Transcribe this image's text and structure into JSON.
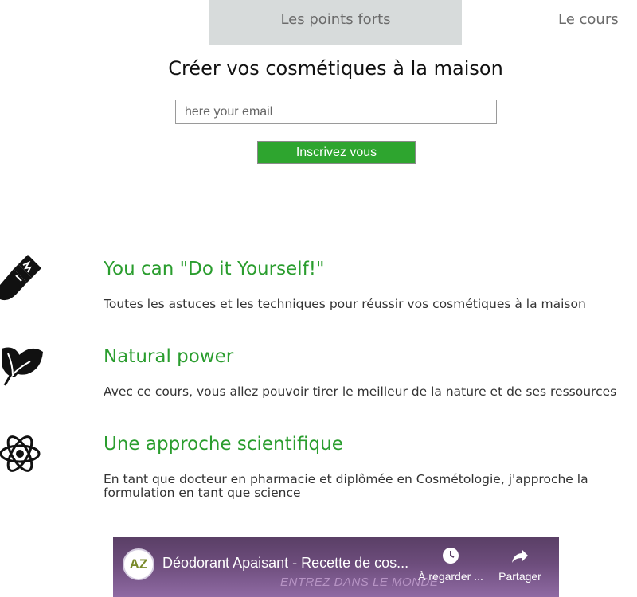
{
  "nav": {
    "tabs": [
      {
        "label": "Les points forts",
        "active": true
      },
      {
        "label": "Le cours",
        "active": false
      }
    ]
  },
  "hero": {
    "title": "Créer vos cosmétiques à la maison",
    "email_placeholder": "here your email",
    "subscribe_label": "Inscrivez vous"
  },
  "features": [
    {
      "icon": "paintbrush-icon",
      "title": "You can \"Do it Yourself!\"",
      "text": "Toutes les astuces et les techniques pour réussir vos cosmétiques à la maison"
    },
    {
      "icon": "leaf-icon",
      "title": "Natural power",
      "text": "Avec ce cours, vous allez pouvoir tirer le meilleur de la nature et de ses ressources"
    },
    {
      "icon": "atom-icon",
      "title": "Une approche scientifique",
      "text": "En tant que docteur en pharmacie et diplômée en Cosmétologie, j'approche la formulation en tant que science"
    }
  ],
  "video": {
    "channel_logo": "AZ",
    "title": "Déodorant Apaisant - Recette de cos...",
    "watermark": "ENTREZ DANS LE MONDE",
    "watch_later": "À regarder ...",
    "share": "Partager"
  },
  "colors": {
    "accent_green": "#2a9d2e",
    "button_green": "#2ea52f",
    "active_tab_bg": "#d7dbdb"
  }
}
